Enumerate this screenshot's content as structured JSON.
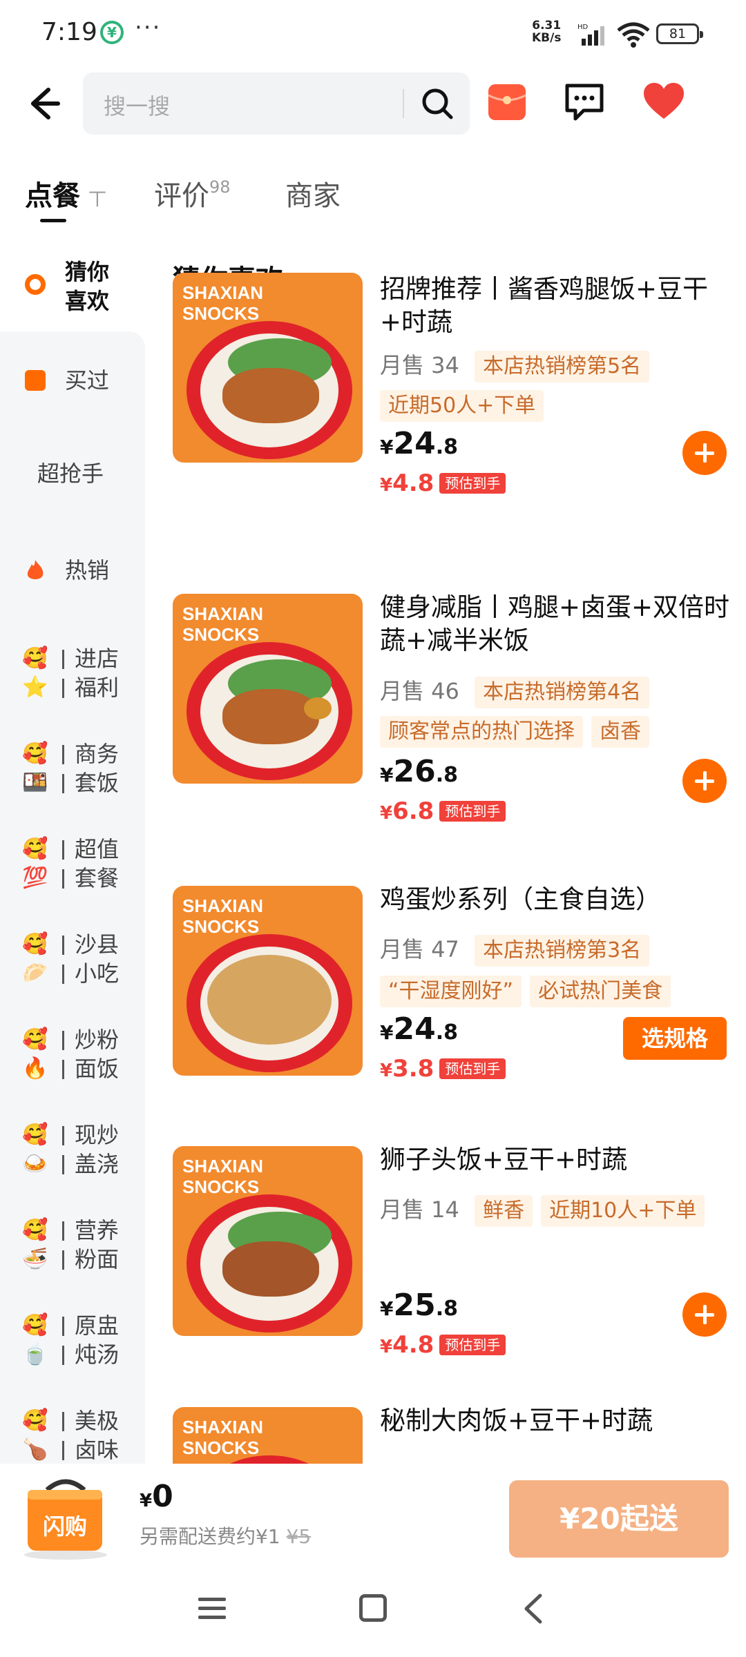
{
  "status": {
    "time": "7:19",
    "dots": "···",
    "speed_value": "6.31",
    "speed_unit": "KB/s",
    "network": "HD",
    "battery": "81"
  },
  "header": {
    "search_placeholder": "搜一搜",
    "icons": [
      "back-arrow-icon",
      "search-icon",
      "red-packet-icon",
      "message-icon",
      "heart-icon"
    ]
  },
  "tabs": [
    {
      "label": "点餐",
      "extra": "丅"
    },
    {
      "label": "评价",
      "count": "98"
    },
    {
      "label": "商家"
    }
  ],
  "sidebar": {
    "items": [
      {
        "label": "猜你\n喜欢",
        "line1": "猜你",
        "line2": "喜欢"
      },
      {
        "label": "买过"
      },
      {
        "label": "超抢手"
      },
      {
        "label": "热销"
      },
      {
        "emoji1": "🥰",
        "emoji2": "⭐",
        "line1": "进店",
        "line2": "福利"
      },
      {
        "emoji1": "🥰",
        "emoji2": "🍱",
        "line1": "商务",
        "line2": "套饭"
      },
      {
        "emoji1": "🥰",
        "emoji2": "💯",
        "line1": "超值",
        "line2": "套餐"
      },
      {
        "emoji1": "🥰",
        "emoji2": "🥟",
        "line1": "沙县",
        "line2": "小吃"
      },
      {
        "emoji1": "🥰",
        "emoji2": "🔥",
        "line1": "炒粉",
        "line2": "面饭"
      },
      {
        "emoji1": "🥰",
        "emoji2": "🍛",
        "line1": "现炒",
        "line2": "盖浇"
      },
      {
        "emoji1": "🥰",
        "emoji2": "🍜",
        "line1": "营养",
        "line2": "粉面"
      },
      {
        "emoji1": "🥰",
        "emoji2": "🍵",
        "line1": "原盅",
        "line2": "炖汤"
      },
      {
        "emoji1": "🥰",
        "emoji2": "🍗",
        "line1": "美极",
        "line2": "卤味"
      }
    ]
  },
  "section_title": "猜你喜欢",
  "brand": {
    "line1": "SHAXIAN",
    "line2": "SNOCKS",
    "color": "#f28a2e"
  },
  "items": [
    {
      "name": "招牌推荐丨酱香鸡腿饭+豆干+时蔬",
      "sales": "月售 34",
      "tags": [
        "本店热销榜第5名",
        "近期50人+下单"
      ],
      "price_int": "24",
      "price_dec": ".8",
      "est_price": "4.8",
      "est_label": "预估到手",
      "action": "add"
    },
    {
      "name": "健身减脂丨鸡腿+卤蛋+双倍时蔬+减半米饭",
      "sales": "月售 46",
      "tags": [
        "本店热销榜第4名",
        "顾客常点的热门选择",
        "卤香"
      ],
      "price_int": "26",
      "price_dec": ".8",
      "est_price": "6.8",
      "est_label": "预估到手",
      "action": "add"
    },
    {
      "name": "鸡蛋炒系列（主食自选）",
      "sales": "月售 47",
      "tags": [
        "本店热销榜第3名",
        "“干湿度刚好”",
        "必试热门美食"
      ],
      "price_int": "24",
      "price_dec": ".8",
      "est_price": "3.8",
      "est_label": "预估到手",
      "action": "spec",
      "spec_label": "选规格"
    },
    {
      "name": "狮子头饭+豆干+时蔬",
      "sales": "月售 14",
      "tags": [
        "鲜香",
        "近期10人+下单"
      ],
      "price_int": "25",
      "price_dec": ".8",
      "est_price": "4.8",
      "est_label": "预估到手",
      "action": "add"
    },
    {
      "name": "秘制大肉饭+豆干+时蔬"
    }
  ],
  "cart": {
    "currency": "¥",
    "total": "0",
    "delivery_note": "另需配送费约¥1",
    "delivery_original": "¥5",
    "checkout_label": "¥20起送",
    "flash_label": "闪购"
  },
  "colors": {
    "accent": "#ff6a00",
    "price_red": "#f0413a",
    "tag_bg": "#fff3e6",
    "tag_text": "#c76b2a"
  }
}
